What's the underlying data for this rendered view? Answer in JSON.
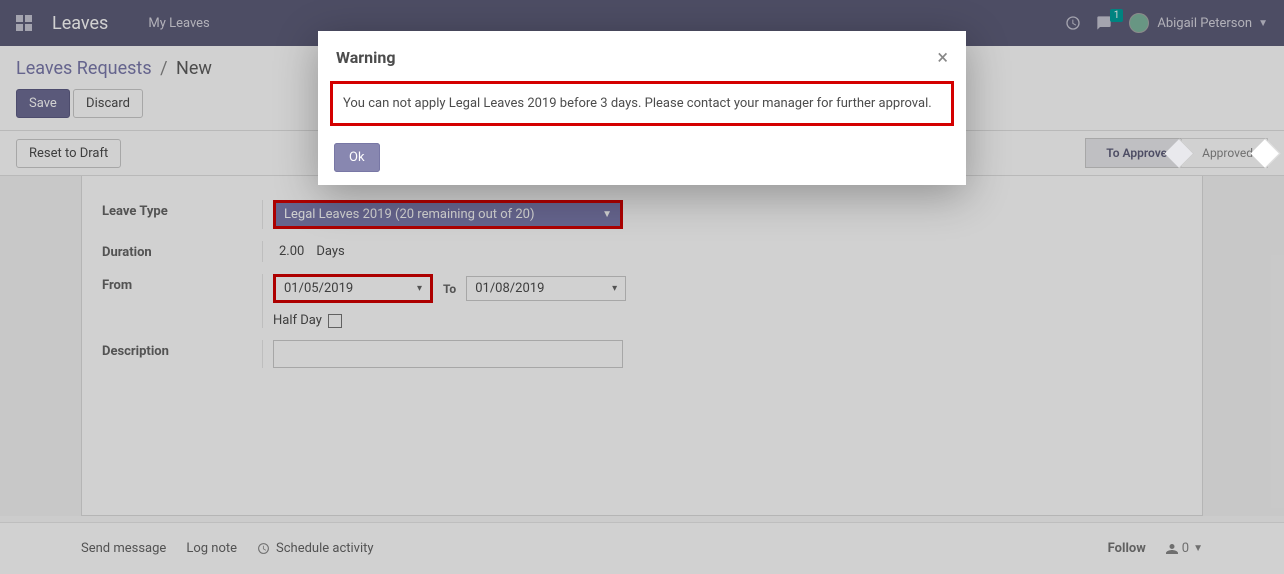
{
  "nav": {
    "app_title": "Leaves",
    "menu_item": "My Leaves",
    "chat_badge": "1",
    "user_name": "Abigail Peterson"
  },
  "breadcrumb": {
    "parent": "Leaves Requests",
    "sep": "/",
    "current": "New"
  },
  "buttons": {
    "save": "Save",
    "discard": "Discard",
    "reset_draft": "Reset to Draft"
  },
  "status": {
    "to_approve": "To Approve",
    "approved": "Approved"
  },
  "form": {
    "leave_type_label": "Leave Type",
    "leave_type_value": "Legal Leaves 2019 (20 remaining out of 20)",
    "duration_label": "Duration",
    "duration_value": "2.00",
    "duration_unit": "Days",
    "from_label": "From",
    "from_value": "01/05/2019",
    "to_label": "To",
    "to_value": "01/08/2019",
    "half_day_label": "Half Day",
    "description_label": "Description",
    "description_value": ""
  },
  "footer": {
    "send_message": "Send message",
    "log_note": "Log note",
    "schedule_activity": "Schedule activity",
    "follow": "Follow",
    "follower_count": "0"
  },
  "modal": {
    "title": "Warning",
    "message": "You can not apply Legal Leaves 2019 before 3 days. Please contact your manager for further approval.",
    "ok": "Ok"
  }
}
